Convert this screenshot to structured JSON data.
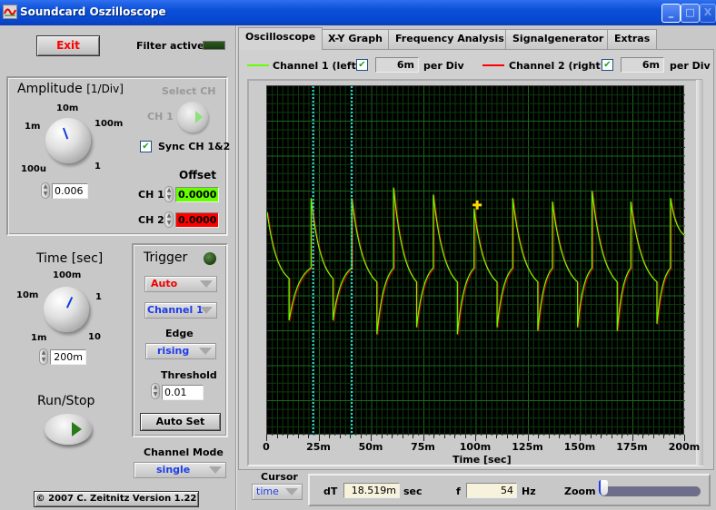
{
  "window": {
    "title": "Soundcard Oszilloscope",
    "minimize": "_",
    "maximize": "□",
    "close": "X"
  },
  "left": {
    "exit_label": "Exit",
    "filter_label": "Filter active",
    "amplitude": {
      "title": "Amplitude",
      "unit": "[1/Div]",
      "ticks": [
        "100u",
        "1m",
        "10m",
        "100m",
        "1"
      ],
      "value": "0.006"
    },
    "select_ch": {
      "label": "Select CH",
      "value": "CH 1"
    },
    "sync": {
      "label": "Sync CH 1&2",
      "checked": true,
      "check": "✔"
    },
    "offset": {
      "label": "Offset",
      "ch1_label": "CH 1",
      "ch1_value": "0.0000",
      "ch2_label": "CH 2",
      "ch2_value": "0.0000"
    },
    "time": {
      "title": "Time [sec]",
      "ticks": [
        "1m",
        "10m",
        "100m",
        "1",
        "10"
      ],
      "value": "200m"
    },
    "trigger": {
      "title": "Trigger",
      "mode": "Auto",
      "channel": "Channel 1",
      "edge_label": "Edge",
      "edge": "rising",
      "threshold_label": "Threshold",
      "threshold": "0.01",
      "autoset_label": "Auto Set"
    },
    "runstop_label": "Run/Stop",
    "channel_mode": {
      "label": "Channel Mode",
      "value": "single"
    },
    "copyright": "© 2007   C. Zeitnitz Version 1.22"
  },
  "tabs": [
    {
      "label": "Oscilloscope",
      "active": true
    },
    {
      "label": "X-Y Graph",
      "active": false
    },
    {
      "label": "Frequency Analysis",
      "active": false
    },
    {
      "label": "Signalgenerator",
      "active": false
    },
    {
      "label": "Extras",
      "active": false
    }
  ],
  "channels": {
    "ch1": {
      "label": "Channel 1 (left)",
      "checked": true,
      "per_div": "6m",
      "unit": "per Div",
      "color": "#66ff00"
    },
    "ch2": {
      "label": "Channel 2 (right)",
      "checked": true,
      "per_div": "6m",
      "unit": "per Div",
      "color": "#ff0000"
    },
    "check": "✔"
  },
  "chart_data": {
    "type": "line",
    "title": "",
    "xlabel": "Time [sec]",
    "ylabel": "",
    "xlim": [
      0,
      0.2
    ],
    "ylim": [
      -5,
      5
    ],
    "x_tick_labels": [
      "0",
      "25m",
      "50m",
      "75m",
      "100m",
      "125m",
      "150m",
      "175m",
      "200m"
    ],
    "grid": true,
    "cursors": [
      0.022,
      0.0405
    ],
    "waveform": "square wave with exponential decay (AC-coupled), period ~18.5ms",
    "series": [
      {
        "name": "Channel 1 (left)",
        "color": "#66ff00",
        "edges": [
          {
            "t": 0.0,
            "type": "start_high",
            "y0": 1.4,
            "y1": -0.5
          },
          {
            "t": 0.0105,
            "type": "fall",
            "y0": -0.5,
            "y1": -1.7
          },
          {
            "t": 0.021,
            "type": "rise",
            "y0": -0.2,
            "y1": 1.8
          },
          {
            "t": 0.0315,
            "type": "fall",
            "y0": -0.5,
            "y1": -1.7
          },
          {
            "t": 0.0405,
            "type": "rise",
            "y0": -0.2,
            "y1": 1.8
          },
          {
            "t": 0.0525,
            "type": "fall",
            "y0": -0.6,
            "y1": -2.1
          },
          {
            "t": 0.0605,
            "type": "rise",
            "y0": -0.2,
            "y1": 2.1
          },
          {
            "t": 0.0715,
            "type": "fall",
            "y0": -0.6,
            "y1": -1.9
          },
          {
            "t": 0.0795,
            "type": "rise",
            "y0": -0.2,
            "y1": 1.9
          },
          {
            "t": 0.091,
            "type": "fall",
            "y0": -0.6,
            "y1": -2.1
          },
          {
            "t": 0.099,
            "type": "rise",
            "y0": -0.2,
            "y1": 1.5
          },
          {
            "t": 0.11,
            "type": "fall",
            "y0": -0.6,
            "y1": -1.9
          },
          {
            "t": 0.1175,
            "type": "rise",
            "y0": -0.2,
            "y1": 1.8
          },
          {
            "t": 0.1295,
            "type": "fall",
            "y0": -0.6,
            "y1": -2.0
          },
          {
            "t": 0.1365,
            "type": "rise",
            "y0": -0.2,
            "y1": 1.7
          },
          {
            "t": 0.1485,
            "type": "fall",
            "y0": -0.6,
            "y1": -1.9
          },
          {
            "t": 0.1555,
            "type": "rise",
            "y0": -0.2,
            "y1": 2.0
          },
          {
            "t": 0.1675,
            "type": "fall",
            "y0": -0.6,
            "y1": -2.0
          },
          {
            "t": 0.174,
            "type": "rise",
            "y0": -0.2,
            "y1": 1.7
          },
          {
            "t": 0.1865,
            "type": "fall",
            "y0": -0.6,
            "y1": -1.8
          },
          {
            "t": 0.193,
            "type": "rise",
            "y0": -0.2,
            "y1": 1.8
          }
        ]
      },
      {
        "name": "Channel 2 (right)",
        "color": "#ff0000",
        "note": "overlaps Channel 1"
      }
    ]
  },
  "bottom": {
    "cursor_label": "Cursor",
    "cursor_mode": "time",
    "dT_label": "dT",
    "dT_value": "18.519m",
    "dT_unit": "sec",
    "f_label": "f",
    "f_value": "54",
    "f_unit": "Hz",
    "zoom_label": "Zoom",
    "zoom_level": 0
  }
}
